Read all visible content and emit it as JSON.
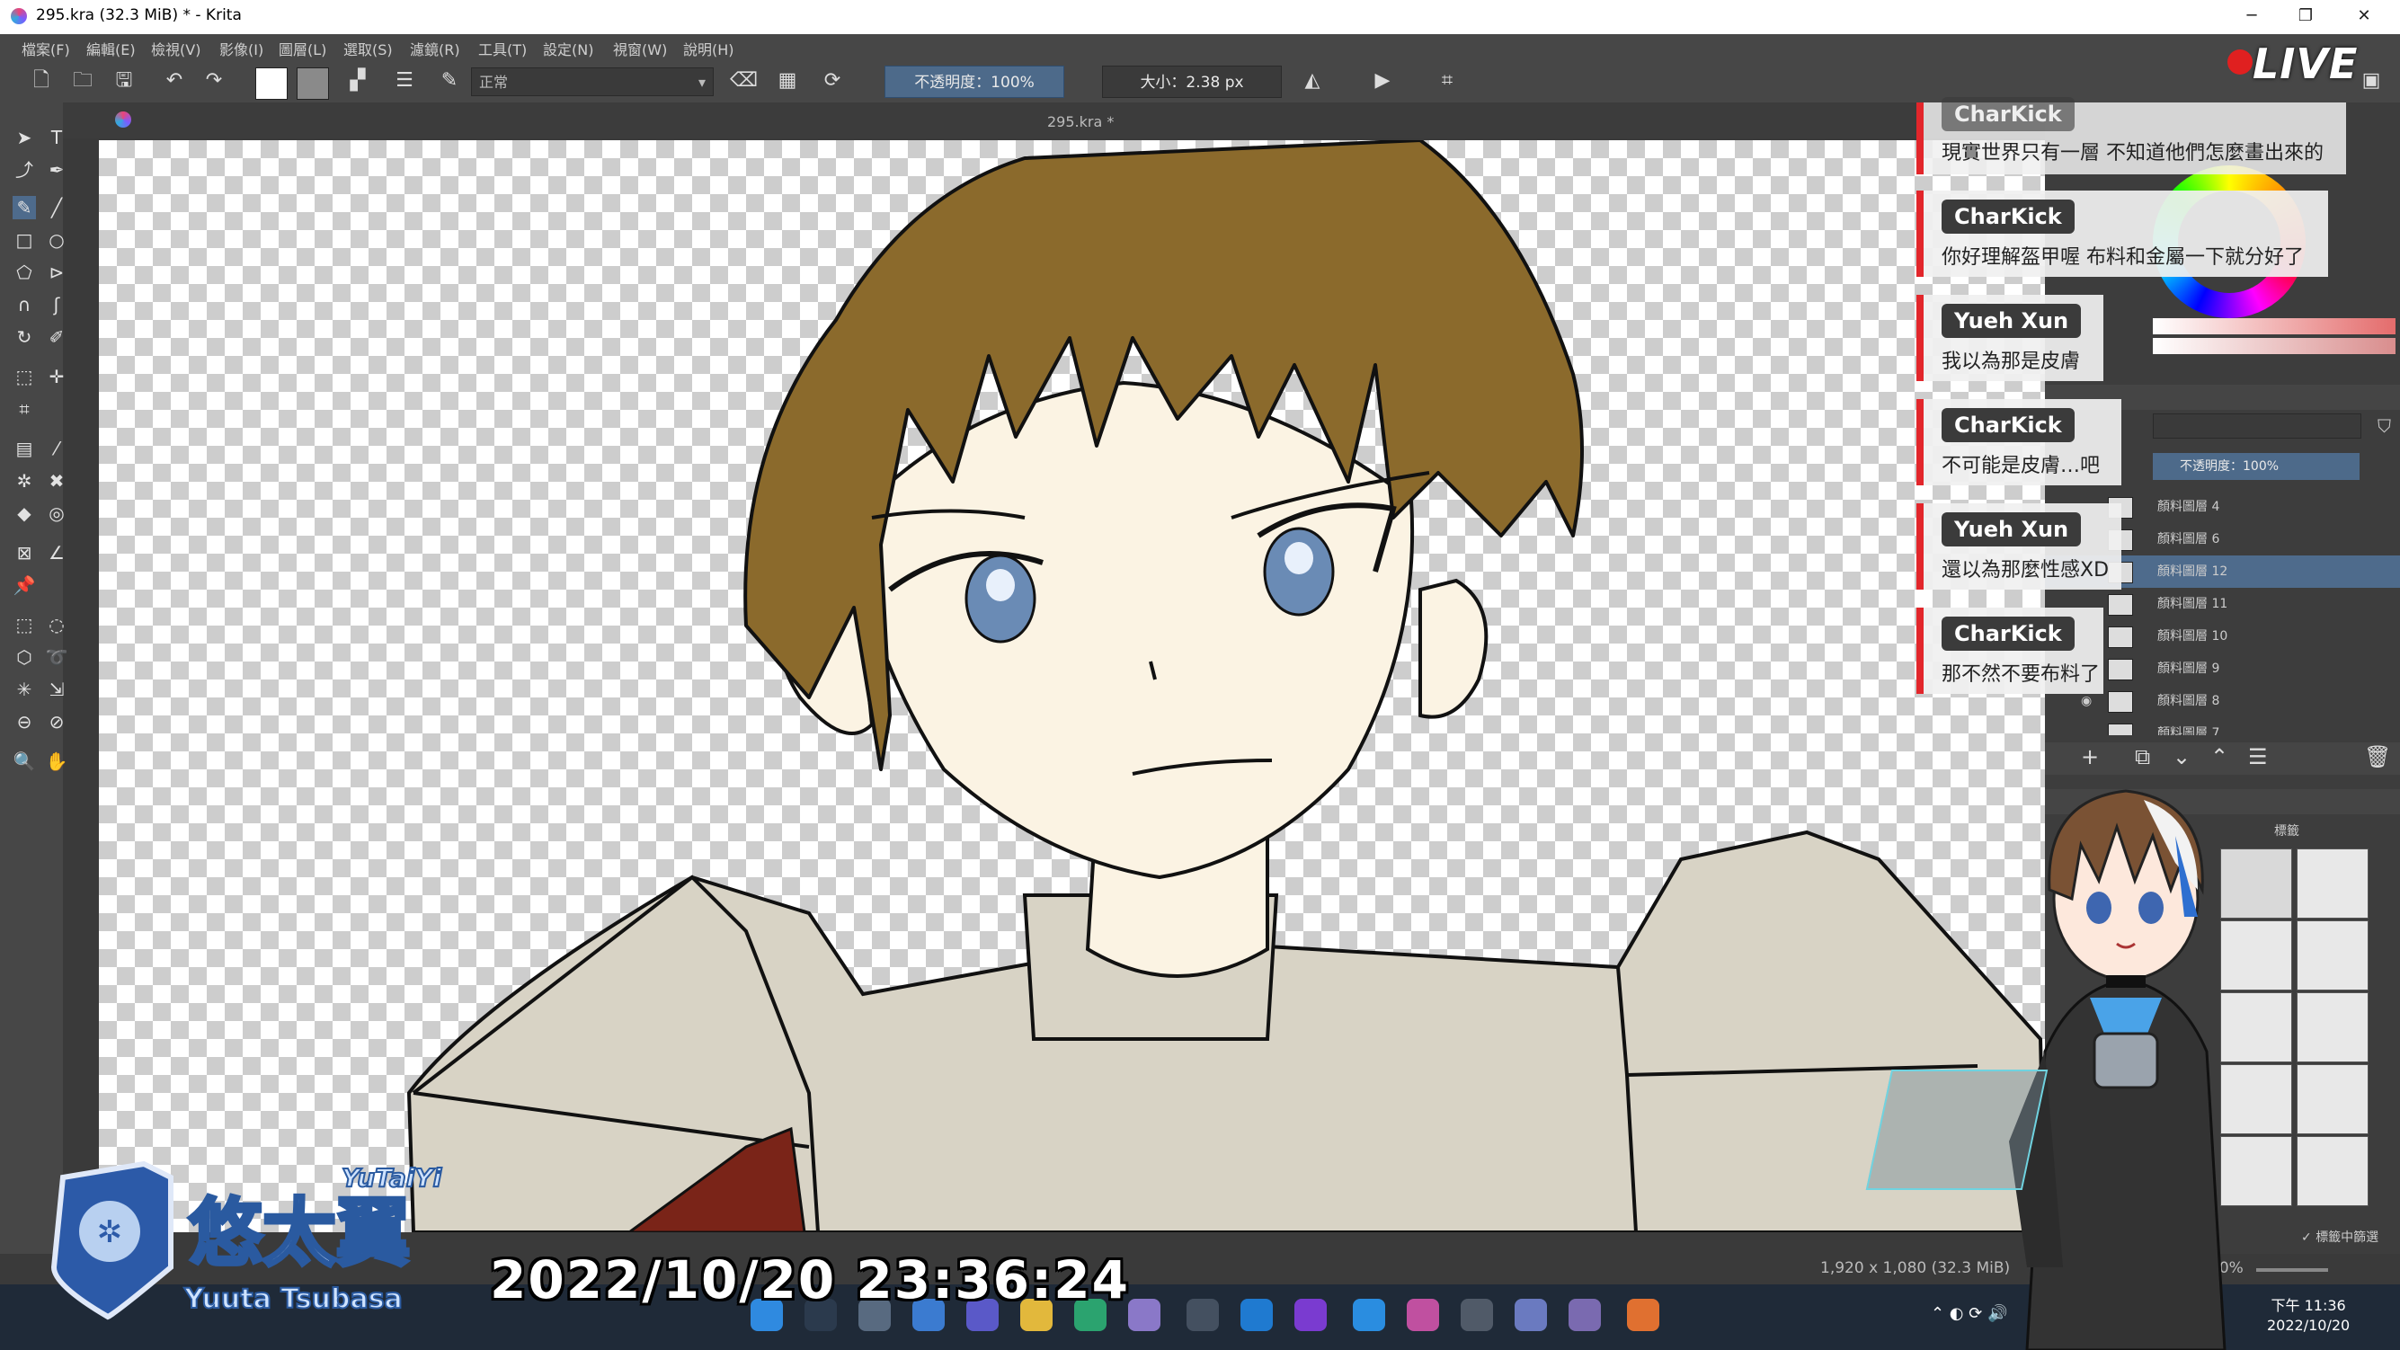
{
  "window": {
    "title": "295.kra (32.3 MiB) * - Krita",
    "minimize_icon": "minimize-icon",
    "maximize_icon": "restore-icon",
    "close_icon": "close-icon"
  },
  "menu": [
    "檔案(F)",
    "編輯(E)",
    "檢視(V)",
    "影像(I)",
    "圖層(L)",
    "選取(S)",
    "濾鏡(R)",
    "工具(T)",
    "設定(N)",
    "視窗(W)",
    "說明(H)"
  ],
  "toolbar": {
    "blend_mode": "正常",
    "opacity": "不透明度：100%",
    "size": "大小：2.38 px"
  },
  "live_badge": "LIVE",
  "document_tab": "295.kra *",
  "chat": [
    {
      "user": "CharKick",
      "message": "現實世界只有一層 不知道他們怎麼畫出來的"
    },
    {
      "user": "CharKick",
      "message": "你好理解盔甲喔 布料和金屬一下就分好了"
    },
    {
      "user": "Yueh Xun",
      "message": "我以為那是皮膚"
    },
    {
      "user": "CharKick",
      "message": "不可能是皮膚…吧"
    },
    {
      "user": "Yueh Xun",
      "message": "還以為那麼性感XD"
    },
    {
      "user": "CharKick",
      "message": "那不然不要布料了"
    }
  ],
  "layers_panel": {
    "opacity": "不透明度：100%",
    "layers": [
      "顏料圖層 4",
      "顏料圖層 6",
      "顏料圖層 12",
      "顏料圖層 11",
      "顏料圖層 10",
      "顏料圖層 9",
      "顏料圖層 8",
      "顏料圖層 7"
    ],
    "selected_index": 2
  },
  "brush_panel": {
    "tag": "標籤",
    "search_in_tags": "標籤中篩選"
  },
  "status": {
    "document_info": "1,920 x 1,080 (32.3 MiB)",
    "zoom": "10%"
  },
  "overlay": {
    "timestamp": "2022/10/20 23:36:24",
    "logo_text": "悠太翼",
    "logo_sub_text": "Yuuta Tsubasa",
    "logo_small_text": "YuTaiYi"
  },
  "taskbar": {
    "time": "下午 11:36",
    "date": "2022/10/20"
  },
  "colors": {
    "hair": "#8b6a2c",
    "skin": "#fbf3e3",
    "armor": "#d8d3c5",
    "sash": "#7a2418",
    "chat_accent": "#e2262b",
    "selection": "#4e6b8c"
  }
}
